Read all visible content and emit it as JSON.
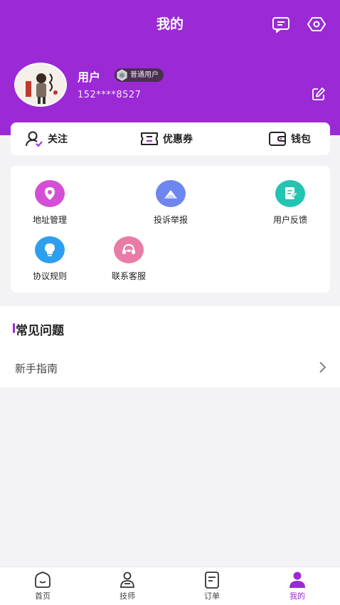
{
  "header": {
    "title": "我的",
    "user": {
      "name": "用户",
      "level": "普通用户",
      "phone": "152****8527"
    }
  },
  "quick_actions": [
    {
      "label": "关注",
      "icon": "follow-user-icon"
    },
    {
      "label": "优惠券",
      "icon": "coupon-icon"
    },
    {
      "label": "钱包",
      "icon": "wallet-icon"
    }
  ],
  "services": [
    {
      "label": "地址管理",
      "icon": "location-pin-icon",
      "color": "#d34fd6"
    },
    {
      "label": "投诉举报",
      "icon": "envelope-icon",
      "color": "#6e86f0"
    },
    {
      "label": "用户反馈",
      "icon": "document-icon",
      "color": "#23c4b2"
    },
    {
      "label": "协议规则",
      "icon": "lightbulb-icon",
      "color": "#2e9fee"
    },
    {
      "label": "联系客服",
      "icon": "headset-icon",
      "color": "#e87ca6"
    }
  ],
  "faq": {
    "title": "常见问题",
    "items": [
      {
        "label": "新手指南"
      }
    ]
  },
  "tabbar": [
    {
      "label": "首页",
      "icon": "home-icon"
    },
    {
      "label": "技师",
      "icon": "technician-icon"
    },
    {
      "label": "订单",
      "icon": "order-icon"
    },
    {
      "label": "我的",
      "icon": "profile-icon",
      "active": true
    }
  ],
  "colors": {
    "brand": "#9b2ad6",
    "background": "#f3f3f5"
  }
}
